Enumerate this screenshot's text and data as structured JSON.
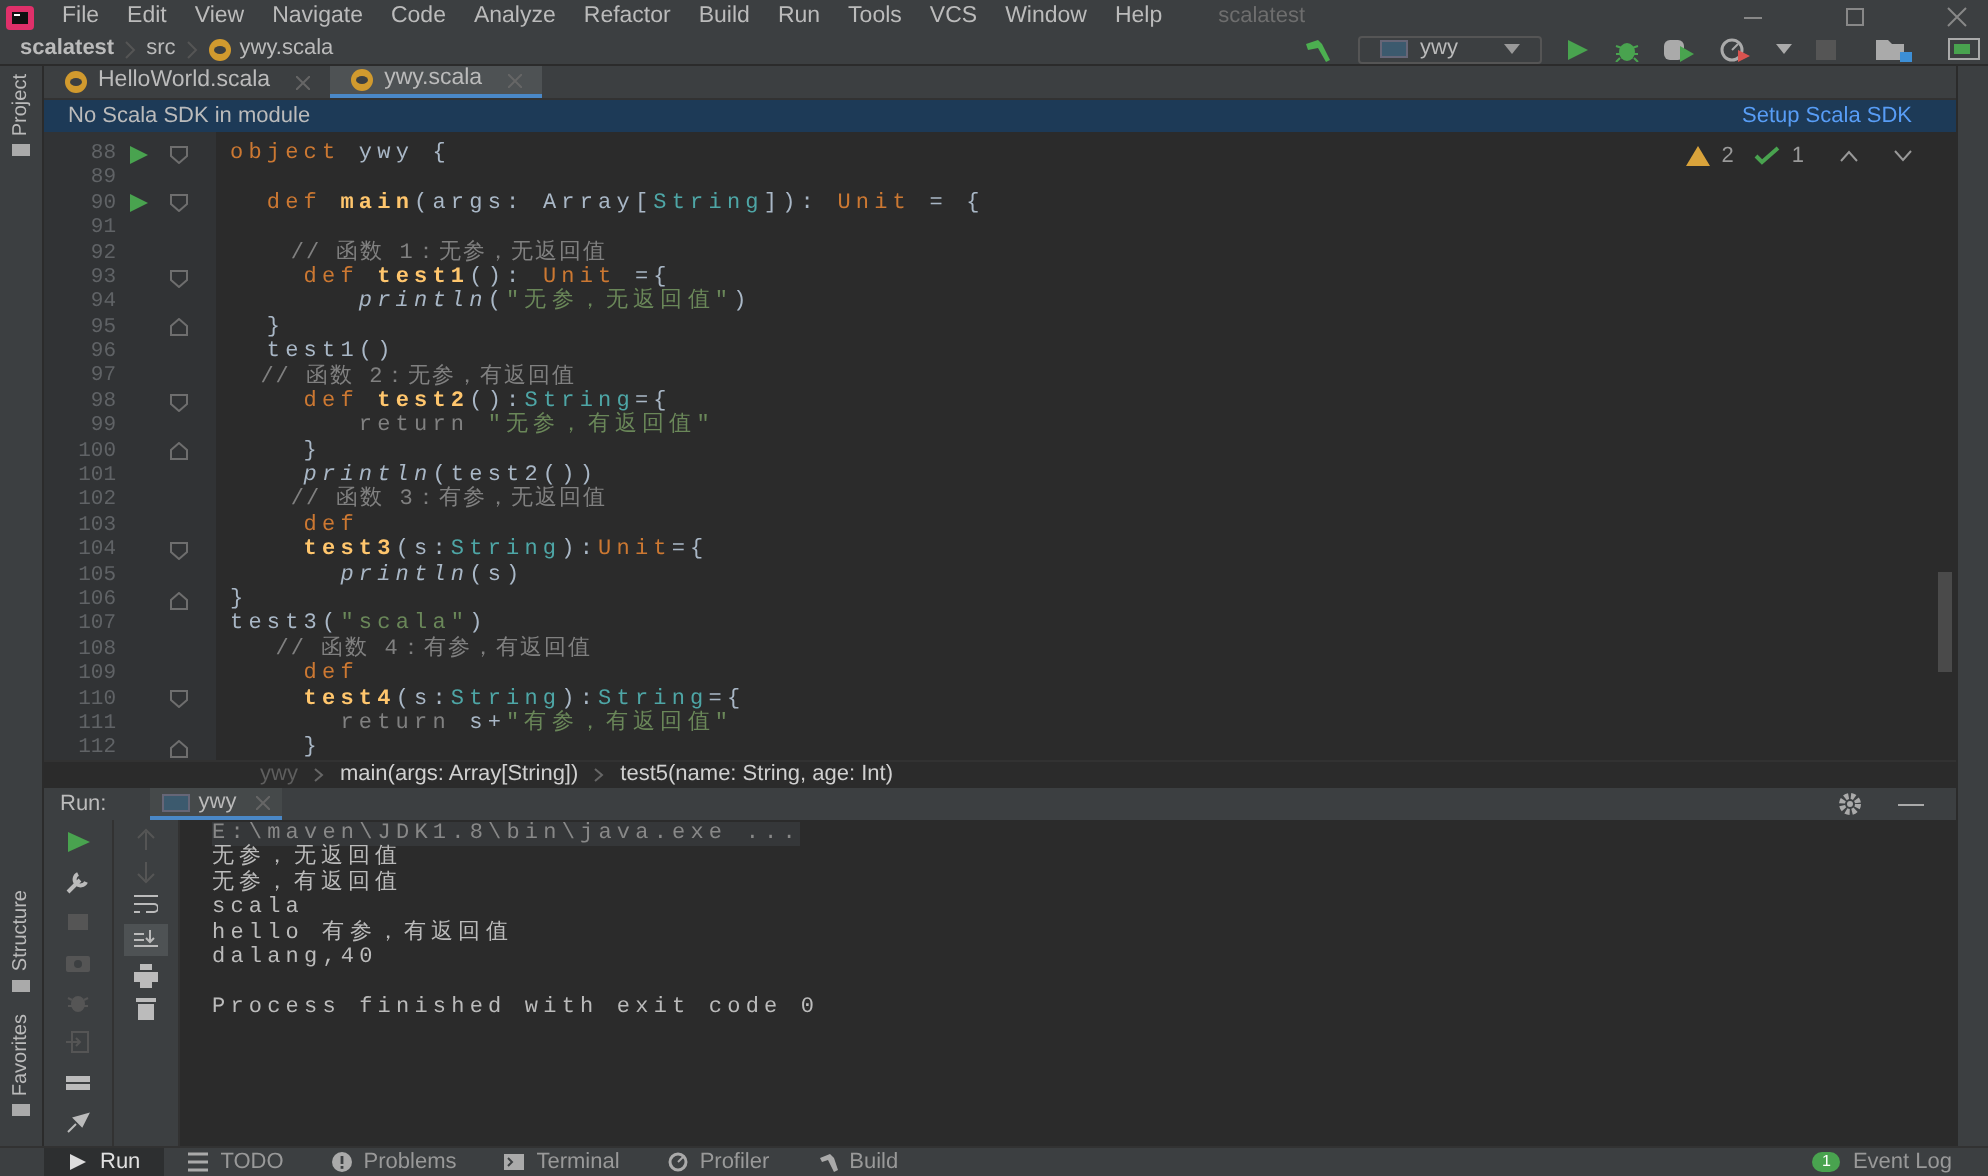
{
  "window": {
    "title": "scalatest"
  },
  "menu": [
    "File",
    "Edit",
    "View",
    "Navigate",
    "Code",
    "Analyze",
    "Refactor",
    "Build",
    "Run",
    "Tools",
    "VCS",
    "Window",
    "Help"
  ],
  "breadcrumb": [
    "scalatest",
    "src",
    "ywy.scala"
  ],
  "run_config": {
    "label": "ywy"
  },
  "side_tools": [
    {
      "label": "Project",
      "kind": "top"
    },
    {
      "label": "Structure",
      "kind": "bottom"
    },
    {
      "label": "Favorites",
      "kind": "bottom"
    }
  ],
  "tabs": [
    {
      "label": "HelloWorld.scala",
      "selected": false
    },
    {
      "label": "ywy.scala",
      "selected": true
    }
  ],
  "notification": {
    "message": "No Scala SDK in module",
    "action": "Setup Scala SDK"
  },
  "inspections": {
    "warnings": "2",
    "typos": "1"
  },
  "code": [
    {
      "n": "88",
      "run": true,
      "fold_start": true,
      "fold_end": false,
      "tokens": [
        {
          "kind": "kw",
          "text": "object"
        },
        {
          "kind": "txt",
          "text": " ywy {"
        }
      ]
    },
    {
      "n": "89",
      "run": false,
      "fold_start": false,
      "fold_end": false
    },
    {
      "n": "90",
      "run": true,
      "fold_start": true,
      "fold_end": false,
      "tokens": [
        {
          "kind": "kw",
          "text": "  def"
        },
        {
          "kind": "id",
          "text": " main"
        },
        {
          "kind": "txt",
          "text": "(args: Array["
        },
        {
          "kind": "type",
          "text": "String"
        },
        {
          "kind": "txt",
          "text": "]): "
        },
        {
          "kind": "kw",
          "text": "Unit"
        },
        {
          "kind": "txt",
          "text": " = {"
        }
      ]
    },
    {
      "n": "91",
      "run": false,
      "fold_start": false,
      "fold_end": false
    },
    {
      "n": "92",
      "run": false,
      "fold_start": false,
      "fold_end": false,
      "tokens": [
        {
          "kind": "cmt",
          "text": "    // 函数 1：无参，无返回值"
        }
      ]
    },
    {
      "n": "93",
      "run": false,
      "fold_start": true,
      "fold_end": false,
      "tokens": [
        {
          "kind": "kw",
          "text": "    def"
        },
        {
          "kind": "id",
          "text": " test1"
        },
        {
          "kind": "txt",
          "text": "(): "
        },
        {
          "kind": "kw",
          "text": "Unit"
        },
        {
          "kind": "txt",
          "text": " ={"
        }
      ]
    },
    {
      "n": "94",
      "run": false,
      "fold_start": false,
      "fold_end": false,
      "tokens": [
        {
          "kind": "call",
          "text": "       println"
        },
        {
          "kind": "txt",
          "text": "("
        },
        {
          "kind": "str",
          "text": "\"无参，无返回值\""
        },
        {
          "kind": "txt",
          "text": ")"
        }
      ]
    },
    {
      "n": "95",
      "run": false,
      "fold_start": false,
      "fold_end": true,
      "tokens": [
        {
          "kind": "txt",
          "text": "  }"
        }
      ]
    },
    {
      "n": "96",
      "run": false,
      "fold_start": false,
      "fold_end": false,
      "tokens": [
        {
          "kind": "txt",
          "text": "  test1()"
        }
      ]
    },
    {
      "n": "97",
      "run": false,
      "fold_start": false,
      "fold_end": false,
      "tokens": [
        {
          "kind": "cmt",
          "text": "  // 函数 2：无参，有返回值"
        }
      ]
    },
    {
      "n": "98",
      "run": false,
      "fold_start": true,
      "fold_end": false,
      "tokens": [
        {
          "kind": "kw",
          "text": "    def"
        },
        {
          "kind": "id",
          "text": " test2"
        },
        {
          "kind": "txt",
          "text": "():"
        },
        {
          "kind": "type",
          "text": "String"
        },
        {
          "kind": "txt",
          "text": "={"
        }
      ]
    },
    {
      "n": "99",
      "run": false,
      "fold_start": false,
      "fold_end": false,
      "tokens": [
        {
          "kind": "dim",
          "text": "       return "
        },
        {
          "kind": "str",
          "text": "\"无参，有返回值\""
        }
      ]
    },
    {
      "n": "100",
      "run": false,
      "fold_start": false,
      "fold_end": true,
      "tokens": [
        {
          "kind": "txt",
          "text": "    }"
        }
      ]
    },
    {
      "n": "101",
      "run": false,
      "fold_start": false,
      "fold_end": false,
      "tokens": [
        {
          "kind": "call",
          "text": "    println"
        },
        {
          "kind": "txt",
          "text": "(test2())"
        }
      ]
    },
    {
      "n": "102",
      "run": false,
      "fold_start": false,
      "fold_end": false,
      "tokens": [
        {
          "kind": "cmt",
          "text": "    // 函数 3：有参，无返回值"
        }
      ]
    },
    {
      "n": "103",
      "run": false,
      "fold_start": false,
      "fold_end": false,
      "tokens": [
        {
          "kind": "kw",
          "text": "    def"
        }
      ]
    },
    {
      "n": "104",
      "run": false,
      "fold_start": true,
      "fold_end": false,
      "tokens": [
        {
          "kind": "id",
          "text": "    test3"
        },
        {
          "kind": "txt",
          "text": "(s:"
        },
        {
          "kind": "type",
          "text": "String"
        },
        {
          "kind": "txt",
          "text": "):"
        },
        {
          "kind": "kw",
          "text": "Unit"
        },
        {
          "kind": "txt",
          "text": "={"
        }
      ]
    },
    {
      "n": "105",
      "run": false,
      "fold_start": false,
      "fold_end": false,
      "tokens": [
        {
          "kind": "call",
          "text": "      println"
        },
        {
          "kind": "txt",
          "text": "(s)"
        }
      ]
    },
    {
      "n": "106",
      "run": false,
      "fold_start": false,
      "fold_end": true,
      "tokens": [
        {
          "kind": "txt",
          "text": "}"
        }
      ]
    },
    {
      "n": "107",
      "run": false,
      "fold_start": false,
      "fold_end": false,
      "tokens": [
        {
          "kind": "txt",
          "text": "test3("
        },
        {
          "kind": "str",
          "text": "\"scala\""
        },
        {
          "kind": "txt",
          "text": ")"
        }
      ]
    },
    {
      "n": "108",
      "run": false,
      "fold_start": false,
      "fold_end": false,
      "tokens": [
        {
          "kind": "cmt",
          "text": "   // 函数 4：有参，有返回值"
        }
      ]
    },
    {
      "n": "109",
      "run": false,
      "fold_start": false,
      "fold_end": false,
      "tokens": [
        {
          "kind": "kw",
          "text": "    def"
        }
      ]
    },
    {
      "n": "110",
      "run": false,
      "fold_start": true,
      "fold_end": false,
      "tokens": [
        {
          "kind": "id",
          "text": "    test4"
        },
        {
          "kind": "txt",
          "text": "(s:"
        },
        {
          "kind": "type",
          "text": "String"
        },
        {
          "kind": "txt",
          "text": "):"
        },
        {
          "kind": "type",
          "text": "String"
        },
        {
          "kind": "txt",
          "text": "={"
        }
      ]
    },
    {
      "n": "111",
      "run": false,
      "fold_start": false,
      "fold_end": false,
      "tokens": [
        {
          "kind": "dim",
          "text": "      return"
        },
        {
          "kind": "txt",
          "text": " s+"
        },
        {
          "kind": "str",
          "text": "\"有参，有返回值\""
        }
      ]
    },
    {
      "n": "112",
      "run": false,
      "fold_start": false,
      "fold_end": true,
      "tokens": [
        {
          "kind": "txt",
          "text": "    }"
        }
      ]
    }
  ],
  "editor_breadcrumb": [
    "ywy",
    "main(args: Array[String])",
    "test5(name: String, age: Int)"
  ],
  "run_panel": {
    "title": "Run:",
    "tab": {
      "label": "ywy",
      "selected": true
    },
    "output": [
      {
        "text": "E:\\maven\\JDK1.8\\bin\\java.exe ...",
        "kind": "command"
      },
      {
        "text": "无参，无返回值",
        "kind": "out"
      },
      {
        "text": "无参，有返回值",
        "kind": "out"
      },
      {
        "text": "scala",
        "kind": "out"
      },
      {
        "text": "hello 有参，有返回值",
        "kind": "out"
      },
      {
        "text": "dalang,40",
        "kind": "out"
      },
      {
        "kind": "blank"
      },
      {
        "text": "Process finished with exit code 0",
        "kind": "out"
      }
    ]
  },
  "bottom_tabs": [
    {
      "label": "Run",
      "selected": true
    },
    {
      "label": "TODO",
      "selected": false
    },
    {
      "label": "Problems",
      "selected": false
    },
    {
      "label": "Terminal",
      "selected": false
    },
    {
      "label": "Profiler",
      "selected": false
    },
    {
      "label": "Build",
      "selected": false
    }
  ],
  "event_log": {
    "label": "Event Log",
    "count": "1"
  }
}
